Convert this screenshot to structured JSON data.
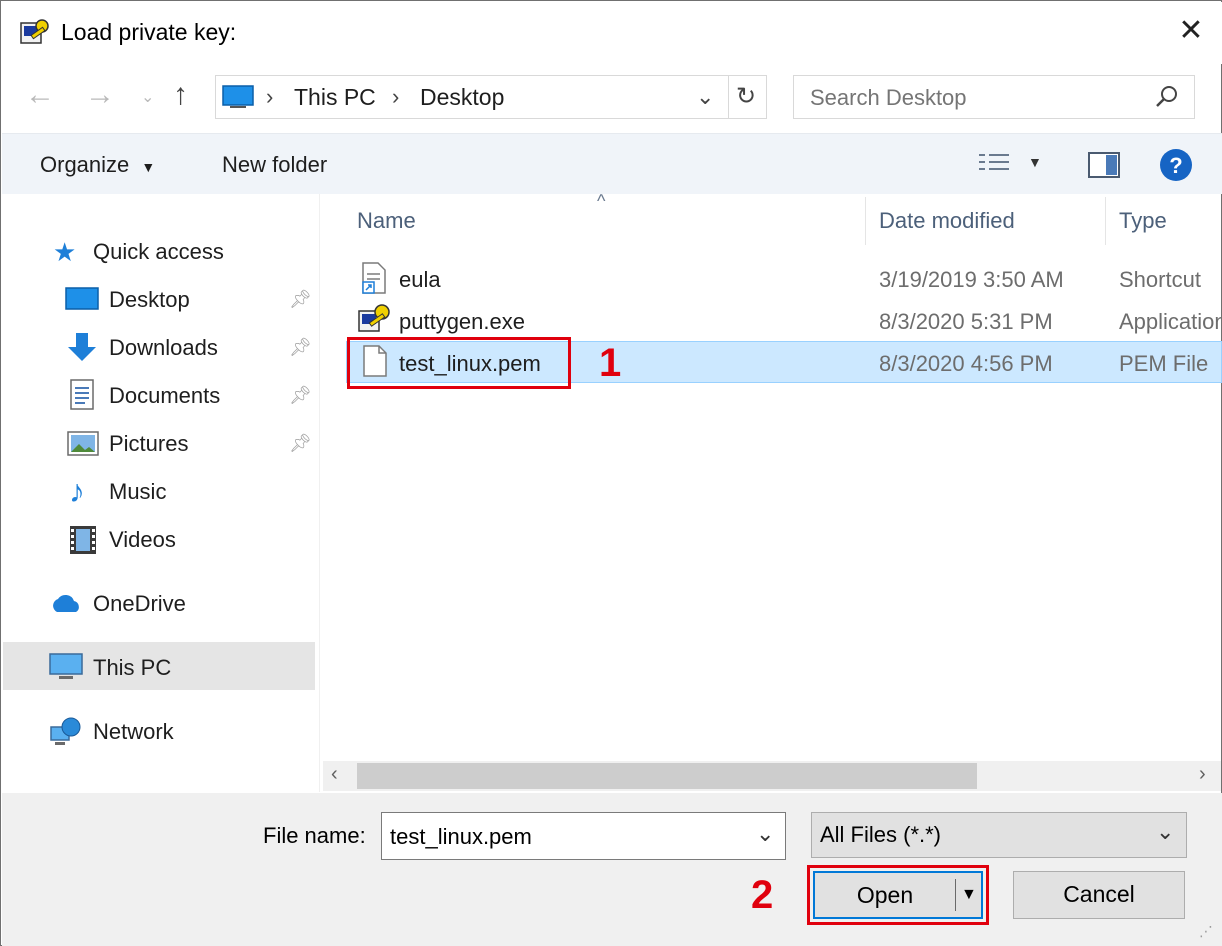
{
  "window": {
    "title": "Load private key:",
    "close_glyph": "✕"
  },
  "address_bar": {
    "crumbs": [
      "This PC",
      "Desktop"
    ],
    "search_placeholder": "Search Desktop"
  },
  "toolbar": {
    "organize_label": "Organize",
    "new_folder_label": "New folder"
  },
  "nav_pane": {
    "quick_access": "Quick access",
    "items": [
      {
        "label": "Desktop",
        "icon": "desktop-icon",
        "pinned": true
      },
      {
        "label": "Downloads",
        "icon": "downloads-icon",
        "pinned": true
      },
      {
        "label": "Documents",
        "icon": "documents-icon",
        "pinned": true
      },
      {
        "label": "Pictures",
        "icon": "pictures-icon",
        "pinned": true
      },
      {
        "label": "Music",
        "icon": "music-icon",
        "pinned": false
      },
      {
        "label": "Videos",
        "icon": "videos-icon",
        "pinned": false
      }
    ],
    "onedrive": "OneDrive",
    "this_pc": "This PC",
    "network": "Network"
  },
  "file_list": {
    "columns": [
      "Name",
      "Date modified",
      "Type"
    ],
    "rows": [
      {
        "name": "eula",
        "date": "3/19/2019 3:50 AM",
        "type": "Shortcut",
        "icon": "shortcut-icon"
      },
      {
        "name": "puttygen.exe",
        "date": "8/3/2020 5:31 PM",
        "type": "Application",
        "icon": "puttygen-icon"
      },
      {
        "name": "test_linux.pem",
        "date": "8/3/2020 4:56 PM",
        "type": "PEM File",
        "icon": "file-icon",
        "selected": true
      }
    ]
  },
  "bottom": {
    "file_name_label": "File name:",
    "file_name_value": "test_linux.pem",
    "filter_value": "All Files (*.*)",
    "open_label": "Open",
    "cancel_label": "Cancel"
  },
  "annotations": {
    "step1": "1",
    "step2": "2"
  },
  "colors": {
    "accent": "#0078d7",
    "selection": "#cce8ff",
    "annotation_red": "#e0000d"
  }
}
